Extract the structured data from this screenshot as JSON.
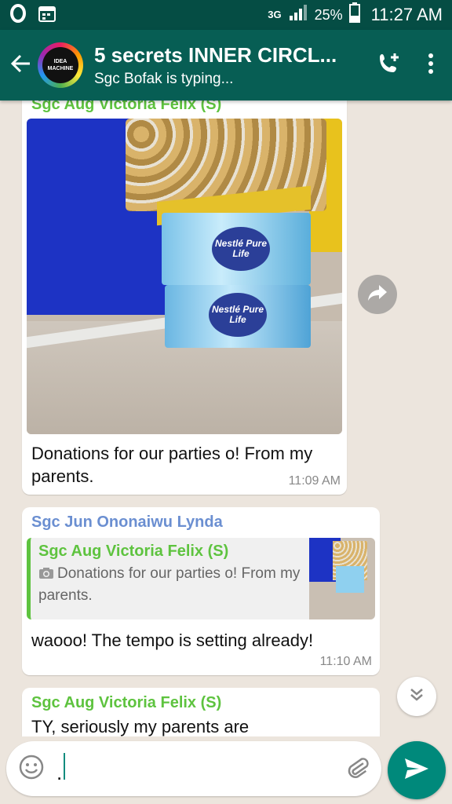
{
  "status_bar": {
    "carrier_icon": "opera-o-icon",
    "network": "3G",
    "battery_percent": "25%",
    "time": "11:27 AM"
  },
  "header": {
    "title": "5 secrets INNER CIRCL...",
    "subtitle": "Sgc Bofak is typing...",
    "avatar_text": "IDEA MACHINE",
    "icons": [
      "back-arrow-icon",
      "add-call-icon",
      "more-vert-icon"
    ]
  },
  "messages": [
    {
      "sender": "Sgc Aug Victoria Felix (S)",
      "sender_color": "#5ec33f",
      "has_photo": true,
      "photo_labels": [
        "Nestlé Pure Life",
        "Nestlé Pure Life"
      ],
      "text": "Donations for our parties o! From my parents.",
      "time": "11:09 AM"
    },
    {
      "sender": "Sgc Jun Ononaiwu Lynda",
      "sender_color": "#6b8fd1",
      "quote": {
        "sender": "Sgc Aug Victoria Felix (S)",
        "text": "Donations for our parties o! From my parents."
      },
      "text": "waooo! The tempo is setting already!",
      "time": "11:10 AM"
    },
    {
      "sender": "Sgc Aug Victoria Felix (S)",
      "sender_color": "#5ec33f",
      "text": "TY, seriously my parents are"
    }
  ],
  "composer": {
    "value": "."
  },
  "colors": {
    "header_bg": "#075e54",
    "status_bg": "#054d44",
    "send_button": "#00897b",
    "chat_bg": "#ece5dd"
  }
}
